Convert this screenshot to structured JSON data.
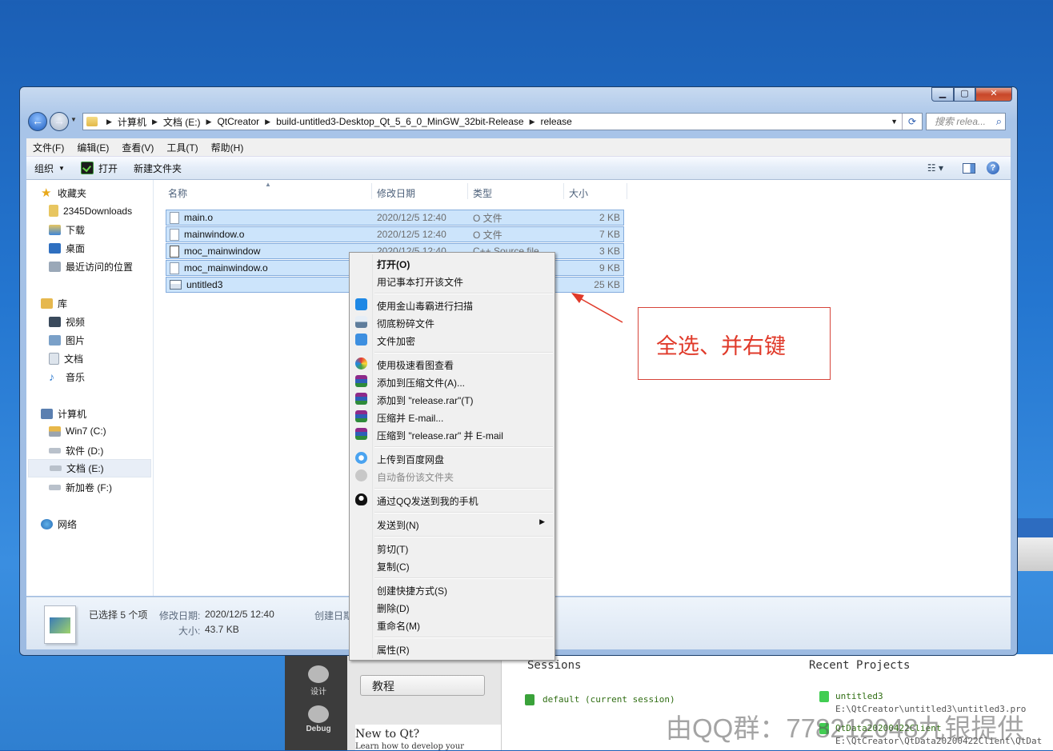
{
  "explorer": {
    "address": [
      "计算机",
      "文档 (E:)",
      "QtCreator",
      "build-untitled3-Desktop_Qt_5_6_0_MinGW_32bit-Release",
      "release"
    ],
    "search_placeholder": "搜索 relea...",
    "menu": [
      "文件(F)",
      "编辑(E)",
      "查看(V)",
      "工具(T)",
      "帮助(H)"
    ],
    "toolbar": {
      "organize": "组织",
      "open": "打开",
      "new_folder": "新建文件夹"
    },
    "nav": {
      "favorites": "收藏夹",
      "fav_items": [
        "2345Downloads",
        "下载",
        "桌面",
        "最近访问的位置"
      ],
      "libraries": "库",
      "lib_items": [
        "视频",
        "图片",
        "文档",
        "音乐"
      ],
      "computer": "计算机",
      "drives": [
        "Win7 (C:)",
        "软件 (D:)",
        "文档 (E:)",
        "新加卷 (F:)"
      ],
      "network": "网络"
    },
    "columns": {
      "name": "名称",
      "date": "修改日期",
      "type": "类型",
      "size": "大小"
    },
    "files": [
      {
        "name": "main.o",
        "date": "2020/12/5 12:40",
        "type": "O 文件",
        "size": "2 KB"
      },
      {
        "name": "mainwindow.o",
        "date": "2020/12/5 12:40",
        "type": "O 文件",
        "size": "7 KB"
      },
      {
        "name": "moc_mainwindow",
        "date": "2020/12/5 12:40",
        "type": "C++ Source file",
        "size": "3 KB"
      },
      {
        "name": "moc_mainwindow.o",
        "date": "",
        "type": "",
        "size": "9 KB"
      },
      {
        "name": "untitled3",
        "date": "",
        "type": "",
        "size": "25 KB"
      }
    ],
    "status": {
      "selected": "已选择 5 个项",
      "modified_label": "修改日期:",
      "modified_value": "2020/12/5 12:40",
      "created_label": "创建日期",
      "size_label": "大小:",
      "size_value": "43.7 KB"
    }
  },
  "context_menu": {
    "open": "打开(O)",
    "notepad": "用记事本打开该文件",
    "scan": "使用金山毒霸进行扫描",
    "shred": "彻底粉碎文件",
    "encrypt": "文件加密",
    "viewer": "使用极速看图查看",
    "add_archive": "添加到压缩文件(A)...",
    "add_rar": "添加到 \"release.rar\"(T)",
    "compress_email": "压缩并 E-mail...",
    "compress_rar_email": "压缩到 \"release.rar\" 并 E-mail",
    "baidu_upload": "上传到百度网盘",
    "auto_backup": "自动备份该文件夹",
    "qq_send": "通过QQ发送到我的手机",
    "send_to": "发送到(N)",
    "cut": "剪切(T)",
    "copy": "复制(C)",
    "shortcut": "创建快捷方式(S)",
    "delete": "删除(D)",
    "rename": "重命名(M)",
    "properties": "属性(R)"
  },
  "annotation": "全选、并右键",
  "qt": {
    "mode_design": "设计",
    "mode_debug": "Debug",
    "tutorials": "教程",
    "new_to_qt": "New to Qt?",
    "learn": "Learn how to develop your",
    "sessions": "Sessions",
    "session_default": "default (current session)",
    "recent": "Recent Projects",
    "recent1": "untitled3",
    "recent1_path": "E:\\QtCreator\\untitled3\\untitled3.pro",
    "recent2": "QtData20200422Client",
    "recent2_path": "E:\\QtCreator\\QtData20200422Client\\QtDat"
  },
  "watermark": "由QQ群：778212048九银提供",
  "colors": {
    "selection": "#cce4fb",
    "annotation": "#e03a2a"
  }
}
